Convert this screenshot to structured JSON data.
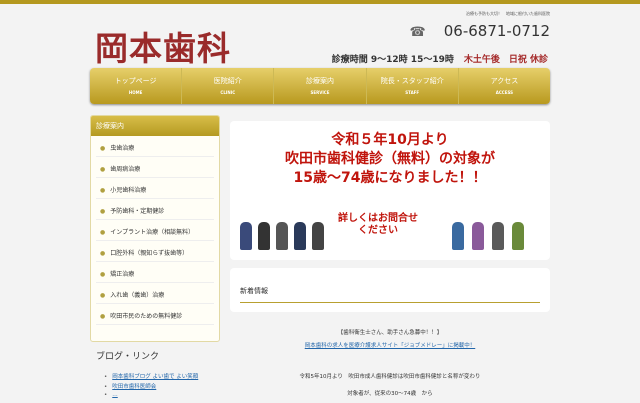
{
  "header": {
    "tagline": "治療も予防も大切！　地域に根付いた歯科医院",
    "logo": "岡本歯科",
    "phone": "06-6871-0712",
    "hours": "診療時間 9〜12時 15〜19時",
    "closed": "木土午後　日祝 休診"
  },
  "nav": [
    {
      "jp": "トップページ",
      "en": "HOME"
    },
    {
      "jp": "医院紹介",
      "en": "CLINIC"
    },
    {
      "jp": "診療案内",
      "en": "SERVICE"
    },
    {
      "jp": "院長・スタッフ紹介",
      "en": "STAFF"
    },
    {
      "jp": "アクセス",
      "en": "ACCESS"
    }
  ],
  "sidebar": {
    "title": "診療案内",
    "items": [
      "虫歯治療",
      "歯周病治療",
      "小児歯科治療",
      "予防歯科・定期健診",
      "インプラント治療（相談無料）",
      "口腔外科（親知らず抜歯等）",
      "矯正治療",
      "入れ歯（義歯）治療",
      "吹田市民のための無料健診"
    ]
  },
  "blog": {
    "title": "ブログ・リンク",
    "links": [
      "岡本歯科ブログ よい歯で よい笑顔",
      "吹田市歯科医師会",
      "…"
    ]
  },
  "banner": {
    "line1": "令和５年10月より",
    "line2": "吹田市歯科健診（無料）の対象が",
    "line3": "15歳〜74歳になりました！！",
    "sub1": "詳しくはお問合せ",
    "sub2": "ください"
  },
  "news": {
    "title": "新着情報"
  },
  "recruit": {
    "text": "【歯科衛生士さん、助手さん急募中！！】",
    "link": "岡本歯科の求人を医療介護求人サイト「ジョブメドレー」に掲載中！"
  },
  "content": {
    "line1": "令和5年10月より　吹田市成人歯科健診は吹田市歯科健診と名称が変わり",
    "line2": "対象者が、従来の30〜74歳　から"
  }
}
